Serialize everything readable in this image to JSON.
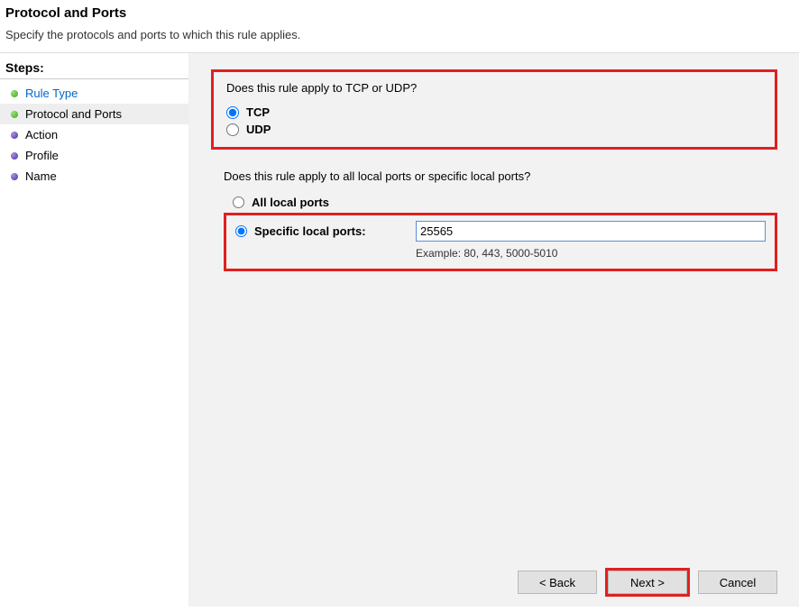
{
  "header": {
    "title": "Protocol and Ports",
    "subtitle": "Specify the protocols and ports to which this rule applies."
  },
  "sidebar": {
    "title": "Steps:",
    "items": [
      {
        "label": "Rule Type",
        "link": true,
        "bullet": "green"
      },
      {
        "label": "Protocol and Ports",
        "current": true,
        "bullet": "green"
      },
      {
        "label": "Action",
        "bullet": "purple"
      },
      {
        "label": "Profile",
        "bullet": "purple"
      },
      {
        "label": "Name",
        "bullet": "purple"
      }
    ]
  },
  "main": {
    "protocol": {
      "question": "Does this rule apply to TCP or UDP?",
      "tcp_label": "TCP",
      "udp_label": "UDP"
    },
    "ports": {
      "question": "Does this rule apply to all local ports or specific local ports?",
      "all_label": "All local ports",
      "specific_label": "Specific local ports:",
      "input_value": "25565",
      "example": "Example: 80, 443, 5000-5010"
    }
  },
  "buttons": {
    "back": "< Back",
    "next": "Next >",
    "cancel": "Cancel"
  }
}
